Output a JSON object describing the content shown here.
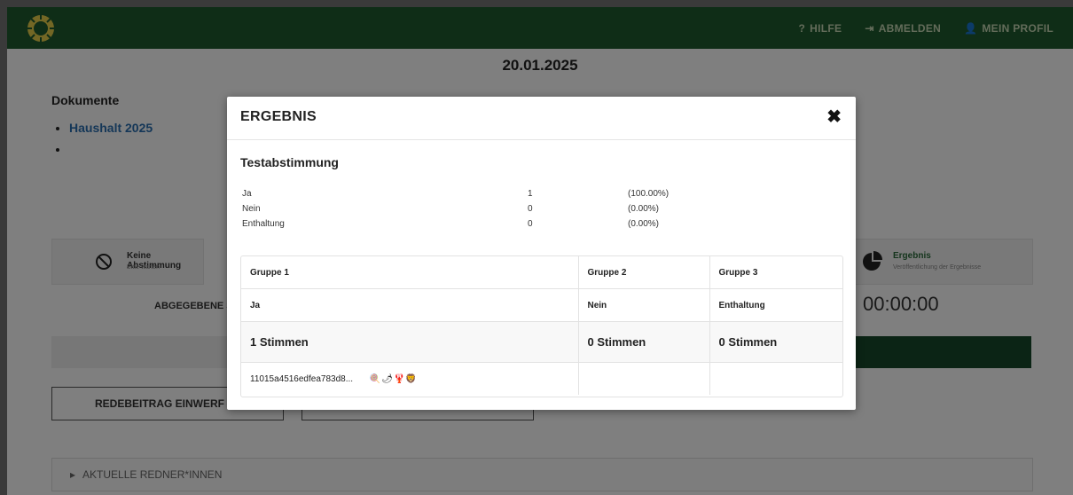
{
  "header": {
    "logo_icon": "sunflower-icon",
    "nav": [
      {
        "icon": "question-icon",
        "glyph": "?",
        "label": "HILFE"
      },
      {
        "icon": "logout-icon",
        "glyph": "⇥",
        "label": "ABMELDEN"
      },
      {
        "icon": "user-icon",
        "glyph": "👤",
        "label": "MEIN PROFIL"
      }
    ]
  },
  "page": {
    "date": "20.01.2025",
    "documents_title": "Dokumente",
    "documents": [
      "Haushalt 2025",
      ""
    ],
    "status_left": {
      "title": "Keine Abstimmung",
      "subtitle": "Bitte warten"
    },
    "status_right": {
      "title": "Ergebnis",
      "subtitle": "Veröffentlichung der Ergebnisse"
    },
    "abgegebene": "ABGEGEBENE ST",
    "timer": "00:00:00",
    "button_redebeitrag": "REDEBEITRAG EINWERF",
    "accordion": "AKTUELLE REDNER*INNEN"
  },
  "modal": {
    "title": "ERGEBNIS",
    "poll_title": "Testabstimmung",
    "results": [
      {
        "label": "Ja",
        "count": "1",
        "percent": "(100.00%)"
      },
      {
        "label": "Nein",
        "count": "0",
        "percent": "(0.00%)"
      },
      {
        "label": "Enthaltung",
        "count": "0",
        "percent": "(0.00%)"
      }
    ],
    "table": {
      "groups": [
        "Gruppe 1",
        "Gruppe 2",
        "Gruppe 3"
      ],
      "options": [
        "Ja",
        "Nein",
        "Enthaltung"
      ],
      "totals": [
        "1 Stimmen",
        "0 Stimmen",
        "0 Stimmen"
      ],
      "voter_hash": "11015a4516edfea783d8...",
      "voter_emojis": "🍭🌶🦞🦁"
    }
  },
  "colors": {
    "topbar": "#1f5a2e",
    "accent_dark": "#17482a",
    "link": "#2a6fb0"
  }
}
